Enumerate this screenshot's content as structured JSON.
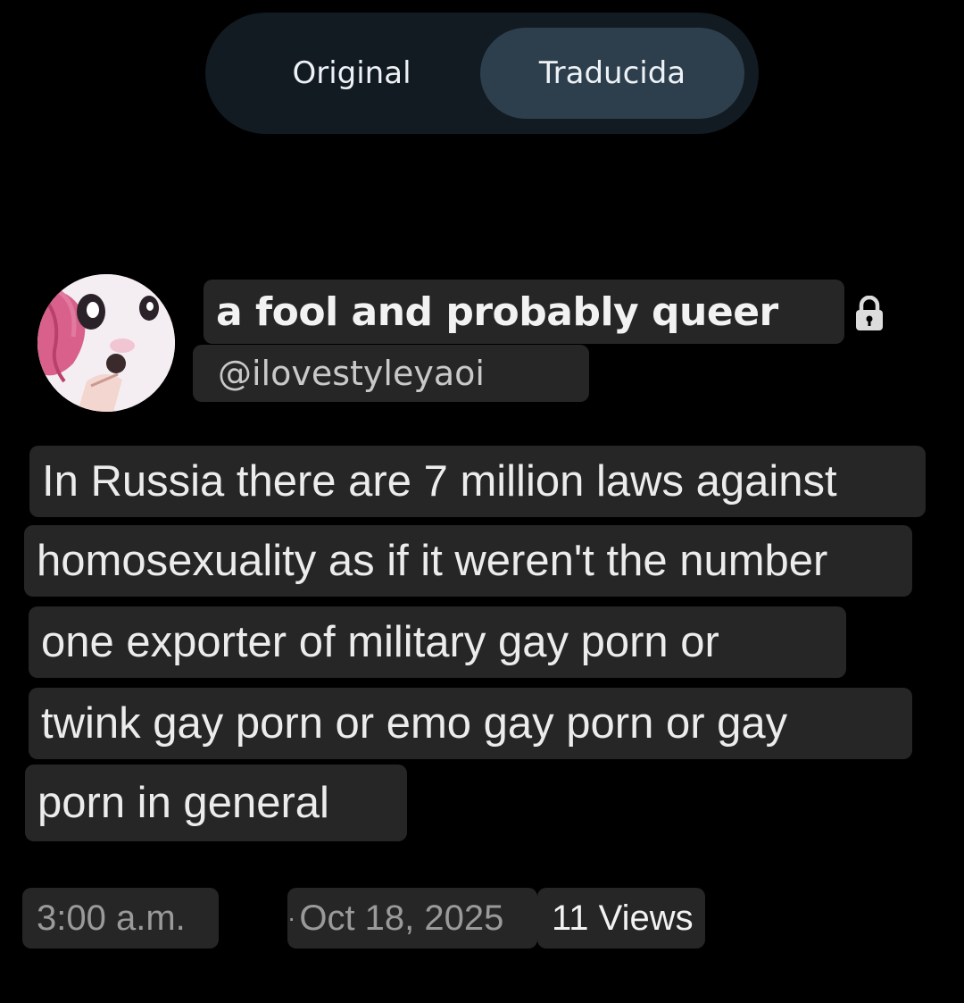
{
  "toggle": {
    "original_label": "Original",
    "translated_label": "Traducida",
    "selected": "Traducida"
  },
  "post": {
    "display_name": "a fool and probably queer",
    "handle": "@ilovestyleyaoi",
    "protected_icon": "lock-icon",
    "text_lines": [
      "In Russia there are 7 million laws against",
      "homosexuality as if it weren't the number",
      "one exporter of military gay porn or",
      "twink gay porn or emo gay porn or gay",
      "porn in general"
    ],
    "time": "3:00 a.m.",
    "separator": "·",
    "date": "Oct 18, 2025",
    "views": "11 Views"
  },
  "colors": {
    "background": "#000000",
    "toggle_track": "#121a22",
    "toggle_selected": "#2d3f4d",
    "highlight": "#262626",
    "text_primary": "#ececec",
    "text_muted": "#9a9a9a"
  }
}
